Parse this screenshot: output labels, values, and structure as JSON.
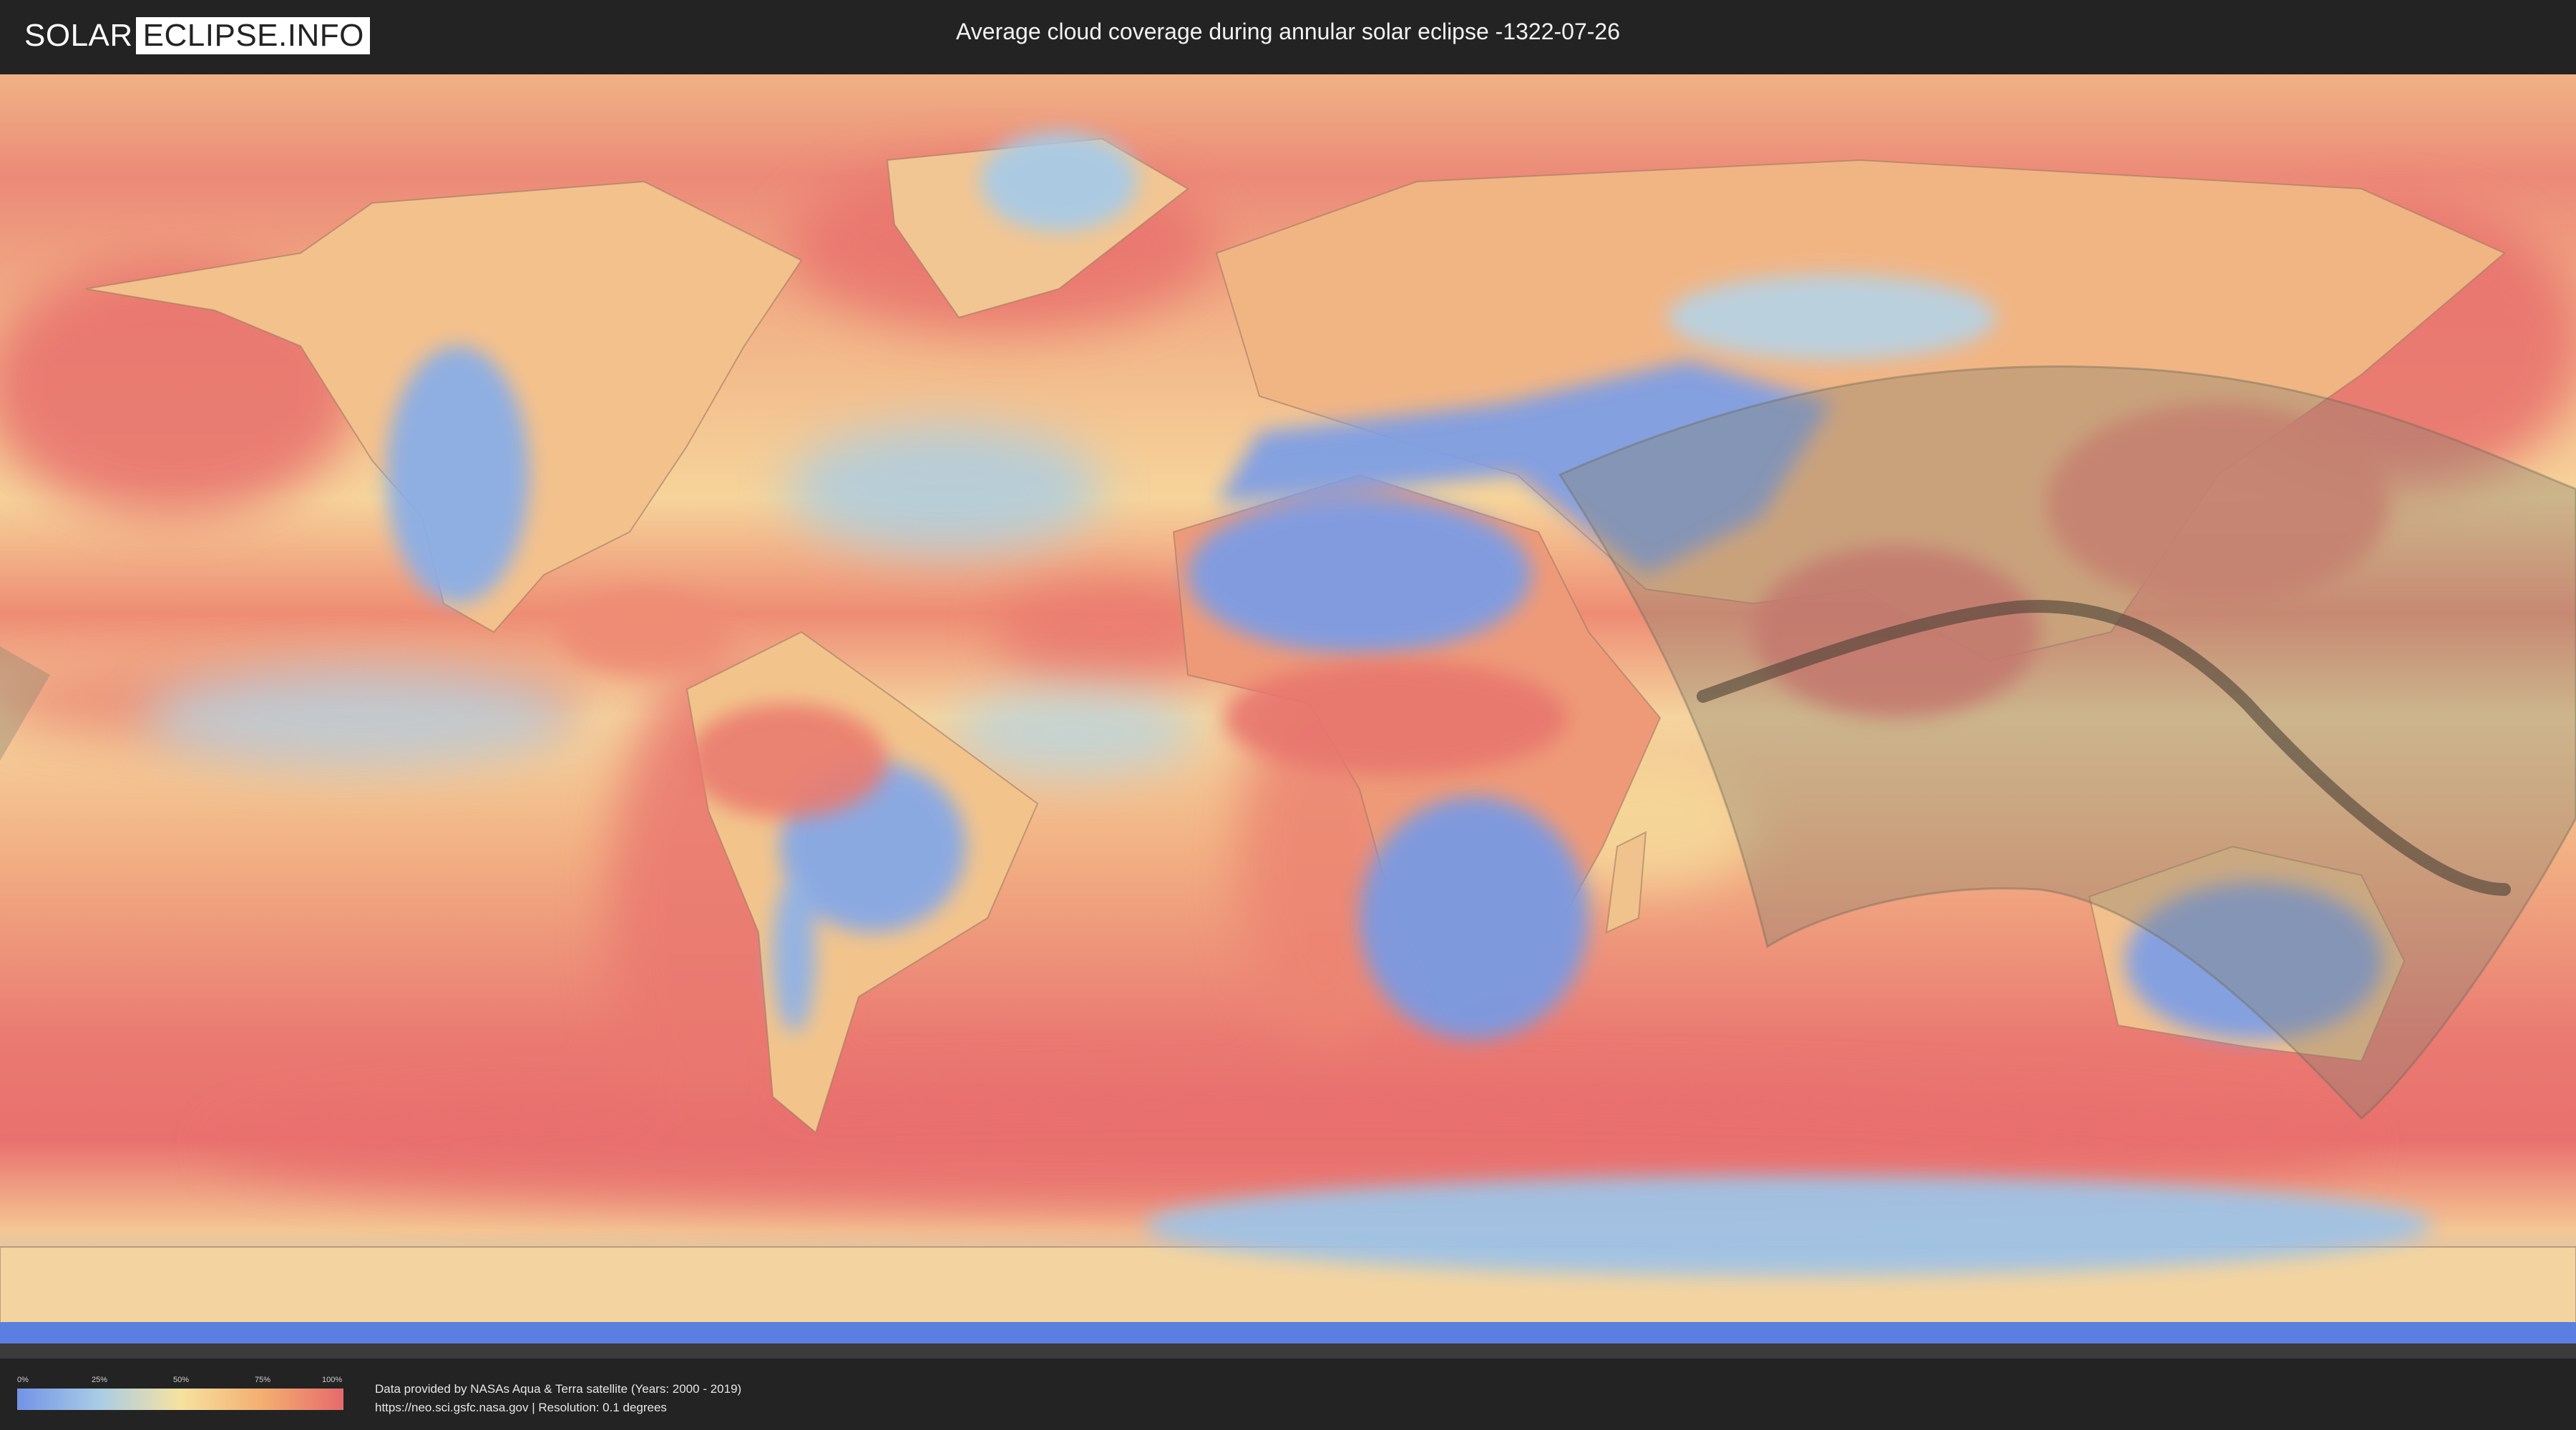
{
  "header": {
    "logo_left": "SOLAR",
    "logo_right": "ECLIPSE.INFO",
    "title": "Average cloud coverage during annular solar eclipse -1322-07-26"
  },
  "map": {
    "projection": "equirectangular",
    "colors": {
      "background_ocean": "#f2a37a",
      "cloudy_red": "#e86f6d",
      "clear_blue": "#7898e2",
      "mid_yellow": "#f6dc9c",
      "eclipse_shadow": "#8a8470",
      "central_line": "#4a4034"
    }
  },
  "legend": {
    "ticks": [
      "0%",
      "25%",
      "50%",
      "75%",
      "100%"
    ],
    "gradient_colors": [
      "#7393e6",
      "#a8cce6",
      "#f6e2a0",
      "#f4ae70",
      "#e66a6c"
    ]
  },
  "footer": {
    "line1": "Data provided by NASAs Aqua & Terra satellite (Years: 2000 - 2019)",
    "line2": "https://neo.sci.gsfc.nasa.gov | Resolution: 0.1 degrees"
  }
}
